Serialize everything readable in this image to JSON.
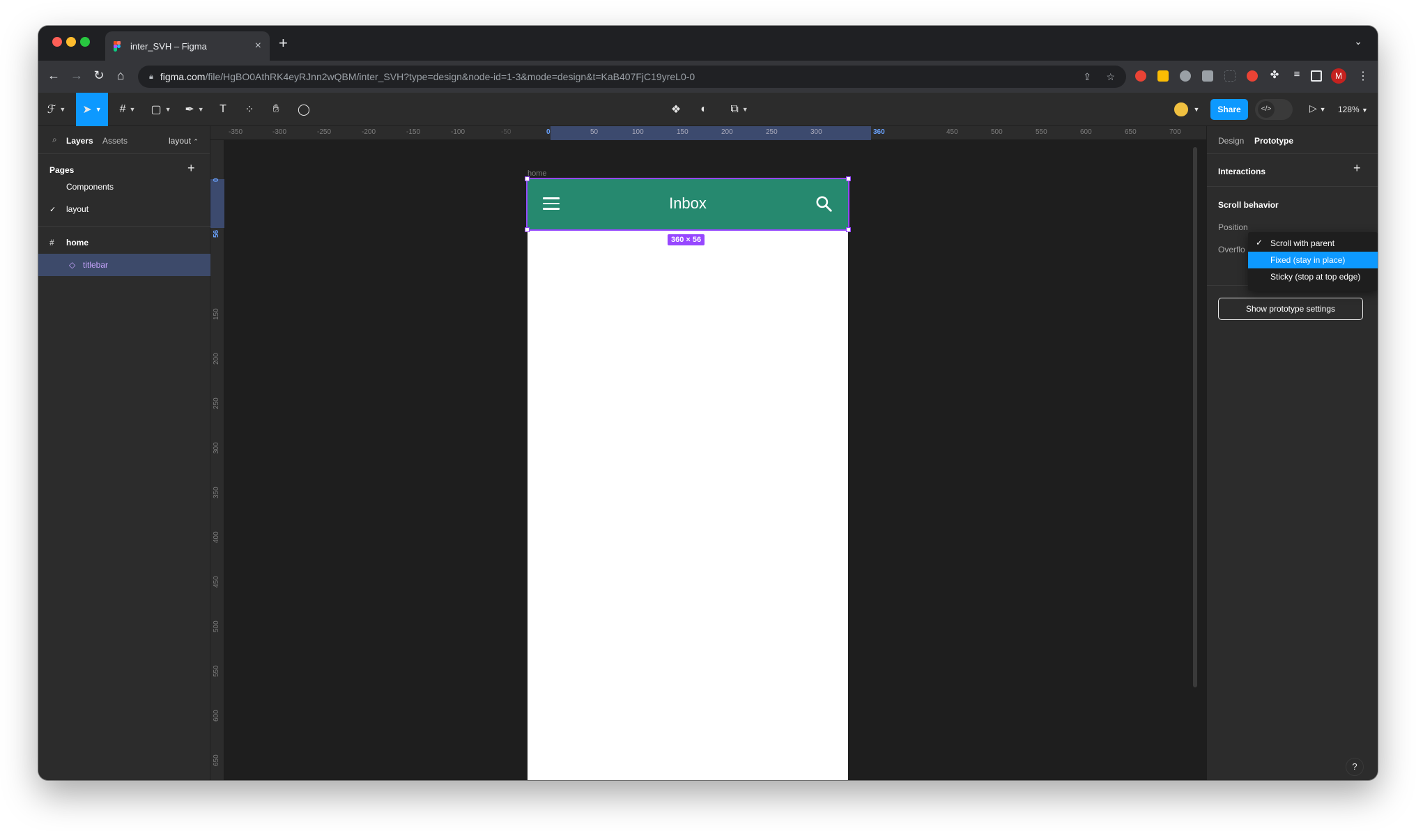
{
  "browser": {
    "tab_title": "inter_SVH – Figma",
    "tab_close": "×",
    "new_tab": "+",
    "tab_list": "⌄",
    "url_host": "figma.com",
    "url_path": "/file/HgBO0AthRK4eyRJnn2wQBM/inter_SVH?type=design&node-id=1-3&mode=design&t=KaB407FjC19yreL0-0",
    "profile_initial": "M",
    "extension_colors": [
      "#ea4335",
      "#fbbc04",
      "#9aa0a6",
      "#9aa0a6",
      "#5f6368",
      "#ea4335",
      "#e8eaed",
      "#e8eaed",
      "#e8eaed"
    ]
  },
  "figma_toolbar": {
    "share_label": "Share",
    "zoom_label": "128%",
    "dev_mode_icon": "code-icon"
  },
  "left_panel": {
    "tab_layers": "Layers",
    "tab_assets": "Assets",
    "page_selector": "layout",
    "pages_heading": "Pages",
    "pages": [
      "Components",
      "layout"
    ],
    "current_page": "layout",
    "layers": [
      {
        "name": "home",
        "icon": "frame-icon"
      },
      {
        "name": "titlebar",
        "icon": "component-instance-icon"
      }
    ]
  },
  "rulers": {
    "h_ticks": [
      "-350",
      "-300",
      "-250",
      "-200",
      "-150",
      "-100",
      "-50",
      "0",
      "50",
      "100",
      "150",
      "200",
      "250",
      "300",
      "360",
      "450",
      "500",
      "550",
      "600",
      "650",
      "700"
    ],
    "v_ticks": [
      "0",
      "56",
      "150",
      "200",
      "250",
      "300",
      "350",
      "400",
      "450",
      "500",
      "550",
      "600",
      "650"
    ]
  },
  "canvas": {
    "frame_label": "home",
    "titlebar_text": "Inbox",
    "titlebar_color": "#26896f",
    "selection_color": "#9747ff",
    "size_badge": "360 × 56"
  },
  "right_panel": {
    "tab_design": "Design",
    "tab_prototype": "Prototype",
    "interactions_label": "Interactions",
    "scroll_behavior_label": "Scroll behavior",
    "position_label": "Position",
    "overflow_label": "Overflo",
    "prototype_settings_button": "Show prototype settings"
  },
  "position_dropdown": {
    "options": [
      "Scroll with parent",
      "Fixed (stay in place)",
      "Sticky (stop at top edge)"
    ],
    "checked": "Scroll with parent",
    "highlighted": "Fixed (stay in place)"
  },
  "help_label": "?"
}
